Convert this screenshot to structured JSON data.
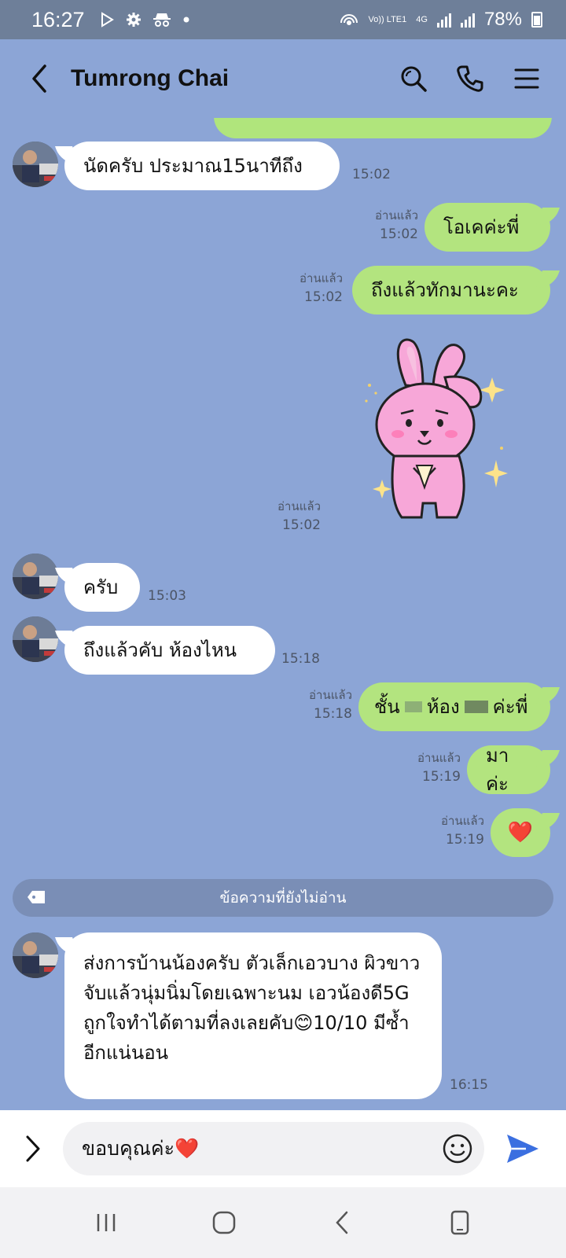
{
  "status_bar": {
    "time": "16:27",
    "network_volte": "Vo)) LTE1",
    "network_gen": "4G",
    "battery": "78%"
  },
  "header": {
    "title": "Tumrong Chai",
    "icons": [
      "back-icon",
      "search-icon",
      "phone-icon",
      "menu-icon"
    ]
  },
  "messages": [
    {
      "id": "m1",
      "side": "in",
      "text": "นัดครับ ประมาณ15นาทีถึง",
      "time": "15:02"
    },
    {
      "id": "m2",
      "side": "out",
      "text": "โอเคค่ะพี่",
      "read": "อ่านแล้ว",
      "time": "15:02"
    },
    {
      "id": "m3",
      "side": "out",
      "text": "ถึงแล้วทักมานะคะ",
      "read": "อ่านแล้ว",
      "time": "15:02"
    },
    {
      "id": "m4",
      "side": "out",
      "type": "sticker",
      "read": "อ่านแล้ว",
      "time": "15:02"
    },
    {
      "id": "m5",
      "side": "in",
      "text": "ครับ",
      "time": "15:03"
    },
    {
      "id": "m6",
      "side": "in",
      "text": "ถึงแล้วคับ ห้องไหน",
      "time": "15:18"
    },
    {
      "id": "m7",
      "side": "out",
      "text_a": "ชั้น",
      "text_b": "ห้อง",
      "text_c": "ค่ะพี่",
      "read": "อ่านแล้ว",
      "time": "15:18"
    },
    {
      "id": "m8",
      "side": "out",
      "text": "มาค่ะ",
      "read": "อ่านแล้ว",
      "time": "15:19"
    },
    {
      "id": "m9",
      "side": "out",
      "text": "❤️",
      "read": "อ่านแล้ว",
      "time": "15:19"
    },
    {
      "id": "m10",
      "side": "in",
      "text": "ส่งการบ้านน้องครับ ตัวเล็กเอวบาง ผิวขาว จับแล้วนุ่มนิ่มโดยเฉพาะนม เอวน้องดี5G ถูกใจทำได้ตามที่ลงเลยคับ😊10/10 มีซ้ำอีกแน่นอน",
      "time": "16:15"
    }
  ],
  "unread_divider": "ข้อความที่ยังไม่อ่าน",
  "composer": {
    "value": "ขอบคุณค่ะ❤️"
  },
  "colors": {
    "background": "#8ca5d6",
    "outgoing_bubble": "#b3e47f",
    "incoming_bubble": "#ffffff",
    "send_accent": "#3b6fe0"
  }
}
